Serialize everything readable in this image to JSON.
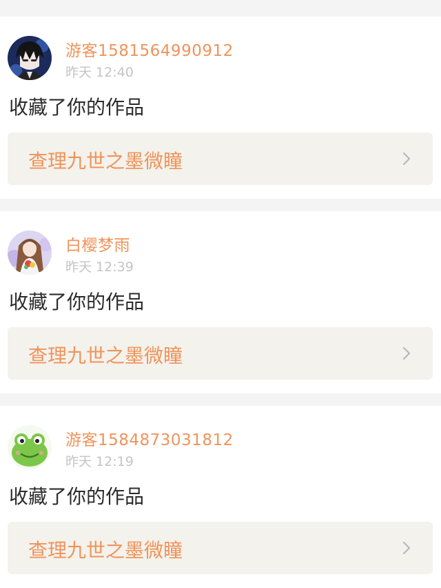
{
  "notifications": [
    {
      "username": "游客1581564990912",
      "time": "昨天 12:40",
      "action": "收藏了你的作品",
      "work_title": "查理九世之墨微瞳",
      "avatar_icon": "anime-boy-avatar"
    },
    {
      "username": "白樱梦雨",
      "time": "昨天 12:39",
      "action": "收藏了你的作品",
      "work_title": "查理九世之墨微瞳",
      "avatar_icon": "anime-girl-avatar"
    },
    {
      "username": "游客1584873031812",
      "time": "昨天 12:19",
      "action": "收藏了你的作品",
      "work_title": "查理九世之墨微瞳",
      "avatar_icon": "green-frog-avatar"
    }
  ],
  "colors": {
    "accent": "#f0935a",
    "timestamp": "#c4c4c4",
    "text": "#2b2b2b",
    "link_bg": "#f3f2ec",
    "page_bg": "#f4f4f4"
  }
}
